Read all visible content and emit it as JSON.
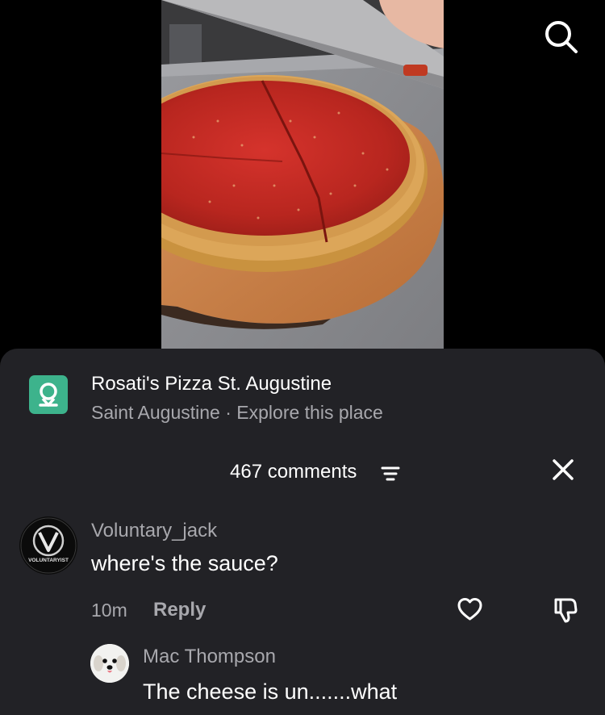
{
  "video": {
    "description_icon": "video-frame-pizza",
    "search_icon": "search-icon"
  },
  "place": {
    "icon": "location-pin-icon",
    "name": "Rosati's Pizza St. Augustine",
    "city": "Saint Augustine",
    "separator": " · ",
    "explore": "Explore this place",
    "accent_color": "#3db38c"
  },
  "comments_header": {
    "count_label": "467 comments",
    "filter_icon": "filter-icon",
    "close_icon": "close-icon"
  },
  "comments": [
    {
      "username": "Voluntary_jack",
      "avatar_text": "VOLUNTARYIST",
      "text": "where's the sauce?",
      "time": "10m",
      "reply_label": "Reply",
      "like_icon": "heart-icon",
      "dislike_icon": "thumbs-down-icon"
    }
  ],
  "replies": [
    {
      "username": "Mac Thompson",
      "text": "The cheese is un.......what"
    }
  ]
}
